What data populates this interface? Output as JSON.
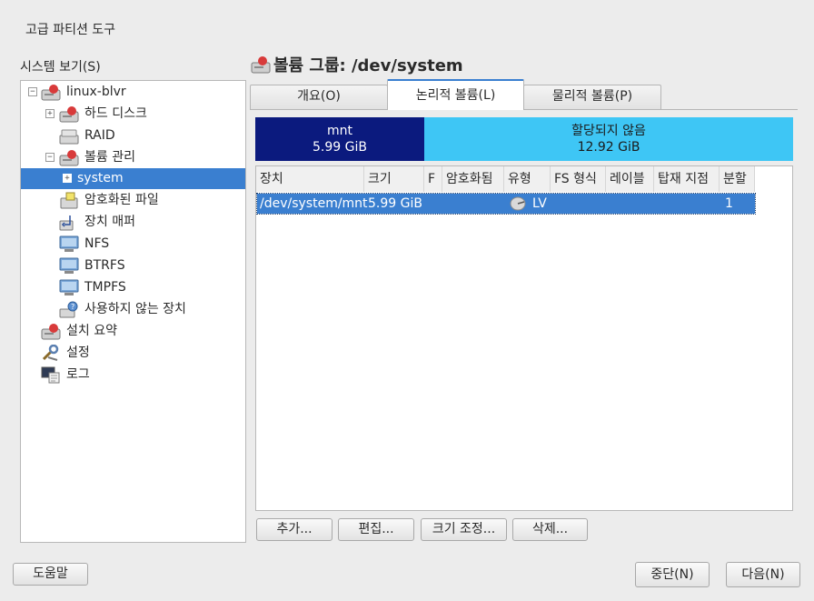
{
  "window": {
    "title": "고급 파티션 도구"
  },
  "left": {
    "label": "시스템 보기(S)"
  },
  "tree": [
    {
      "label": "linux-blvr",
      "icon": "computer-icon",
      "expander": "−"
    },
    {
      "label": "하드 디스크",
      "icon": "hard-disk-icon",
      "expander": "+"
    },
    {
      "label": "RAID",
      "icon": "raid-icon"
    },
    {
      "label": "볼륨 관리",
      "icon": "volume-manager-icon",
      "expander": "−"
    },
    {
      "label": "system",
      "expander": "+",
      "selected": true
    },
    {
      "label": "암호화된 파일",
      "icon": "encrypted-file-icon"
    },
    {
      "label": "장치 매퍼",
      "icon": "device-mapper-icon"
    },
    {
      "label": "NFS",
      "icon": "network-drive-icon"
    },
    {
      "label": "BTRFS",
      "icon": "network-drive-icon"
    },
    {
      "label": "TMPFS",
      "icon": "network-drive-icon"
    },
    {
      "label": "사용하지 않는 장치",
      "icon": "unused-device-icon"
    },
    {
      "label": "설치 요약",
      "icon": "install-summary-icon"
    },
    {
      "label": "설정",
      "icon": "settings-icon"
    },
    {
      "label": "로그",
      "icon": "log-icon"
    }
  ],
  "heading": {
    "title": "볼륨 그룹: /dev/system"
  },
  "tabs": [
    {
      "label": "개요(O)",
      "active": false
    },
    {
      "label": "논리적 볼륨(L)",
      "active": true
    },
    {
      "label": "물리적 볼륨(P)",
      "active": false
    }
  ],
  "usage_bar": {
    "used": {
      "name": "mnt",
      "size": "5.99 GiB",
      "color": "#0b1a7e"
    },
    "free": {
      "name": "할당되지 않음",
      "size": "12.92 GiB",
      "color": "#3ec6f5"
    }
  },
  "table": {
    "columns": [
      "장치",
      "크기",
      "F",
      "암호화됨",
      "유형",
      "FS 형식",
      "레이블",
      "탑재 지점",
      "분할"
    ],
    "rows": [
      {
        "device": "/dev/system/mnt",
        "size": "5.99 GiB",
        "f": "",
        "encrypted": "",
        "type": "LV",
        "fs": "",
        "label": "",
        "mount": "",
        "stripes": "1"
      }
    ]
  },
  "actions": {
    "add": "추가...",
    "edit": "편집...",
    "resize": "크기 조정...",
    "delete": "삭제..."
  },
  "footer": {
    "help": "도움말",
    "abort": "중단(N)",
    "next": "다음(N)"
  },
  "colors": {
    "selection": "#3a7fd0",
    "accent": "#3a7fd0"
  }
}
